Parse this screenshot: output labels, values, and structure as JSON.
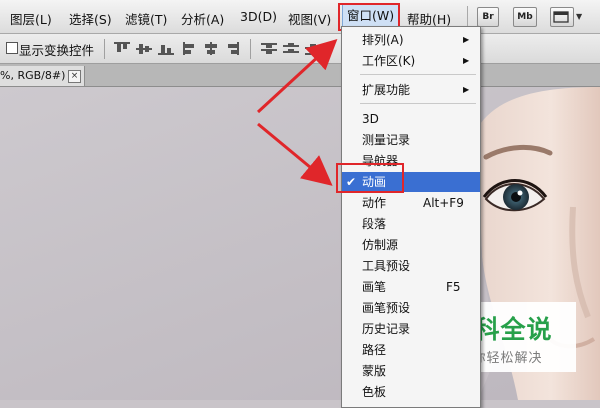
{
  "menubar": {
    "items": [
      "图层(L)",
      "选择(S)",
      "滤镜(T)",
      "分析(A)",
      "3D(D)",
      "视图(V)",
      "窗口(W)",
      "帮助(H)"
    ],
    "active_index": 6,
    "icons": {
      "br": "Br",
      "mb": "Mb"
    }
  },
  "options": {
    "show_transform_label": "显示变换控件",
    "show_transform_checked": false
  },
  "doc_tab": {
    "label": "%, RGB/8#) *",
    "close_glyph": "×"
  },
  "window_menu": {
    "items": [
      {
        "label": "排列(A)",
        "submenu": true
      },
      {
        "label": "工作区(K)",
        "submenu": true
      },
      {
        "label": "扩展功能",
        "submenu": true
      },
      {
        "label": "3D"
      },
      {
        "label": "测量记录"
      },
      {
        "label": "导航器"
      },
      {
        "label": "动画",
        "checked": true,
        "selected": true
      },
      {
        "label": "动作",
        "shortcut": "Alt+F9"
      },
      {
        "label": "段落"
      },
      {
        "label": "仿制源"
      },
      {
        "label": "工具预设"
      },
      {
        "label": "画笔",
        "shortcut": "F5"
      },
      {
        "label": "画笔预设"
      },
      {
        "label": "历史记录"
      },
      {
        "label": "路径"
      },
      {
        "label": "蒙版"
      },
      {
        "label": "色板"
      }
    ]
  },
  "watermark": {
    "title": "百科全说",
    "subtitle": "助你轻松解决"
  },
  "colors": {
    "highlight": "#3a6fd2",
    "annotation": "#e0262a",
    "watermark_green": "#27a04a"
  }
}
